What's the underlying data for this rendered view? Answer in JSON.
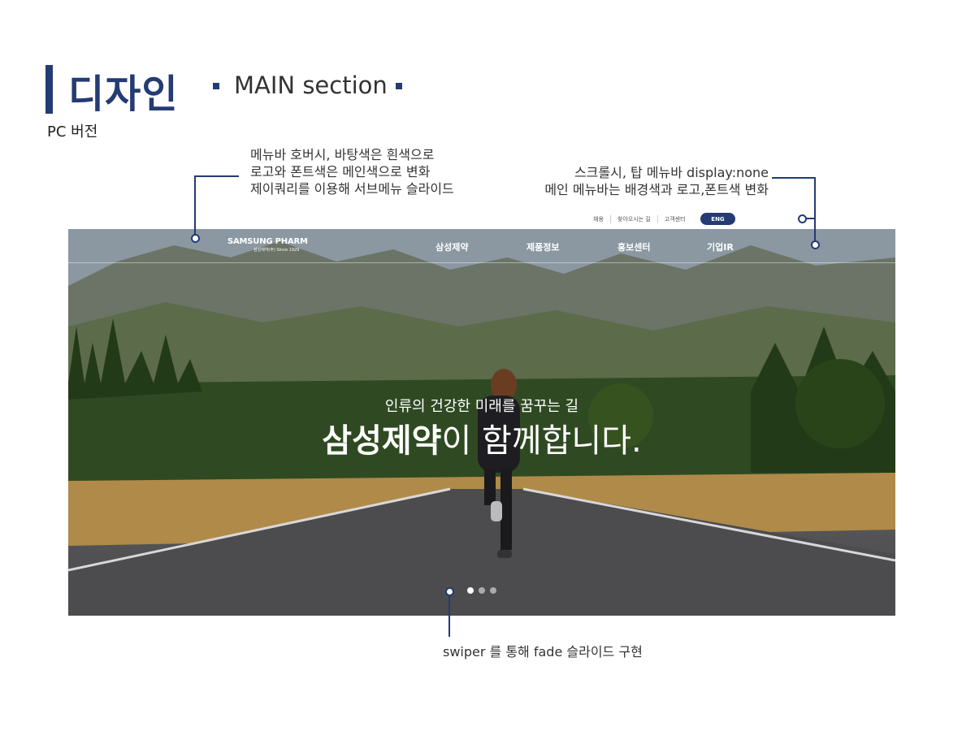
{
  "header": {
    "title": "디자인",
    "section": "MAIN section",
    "platform": "PC 버전"
  },
  "annotations": {
    "menu_hover": "메뉴바 호버시, 바탕색은 흰색으로\n로고와 폰트색은 메인색으로 변화\n제이쿼리를 이용해 서브메뉴 슬라이드",
    "scroll": "스크롤시, 탑 메뉴바 display:none\n메인 메뉴바는 배경색과 로고,폰트색 변화",
    "swiper": "swiper 를 통해 fade 슬라이드 구현"
  },
  "top_util": {
    "links": [
      "채용",
      "찾아오시는 길",
      "고객센터"
    ],
    "lang_button": "ENG"
  },
  "gnb": {
    "logo": "SAMSUNG PHARM",
    "logo_sub": "삼성제약(주) Since 1929",
    "menu": [
      "삼성제약",
      "제품정보",
      "홍보센터",
      "기업IR"
    ]
  },
  "hero": {
    "subtitle": "인류의 건강한 미래를 꿈꾸는 길",
    "headline_bold": "삼성제약",
    "headline_rest": "이 함께합니다.",
    "slide_count": 3,
    "active_slide": 1
  },
  "colors": {
    "accent": "#243b73"
  }
}
